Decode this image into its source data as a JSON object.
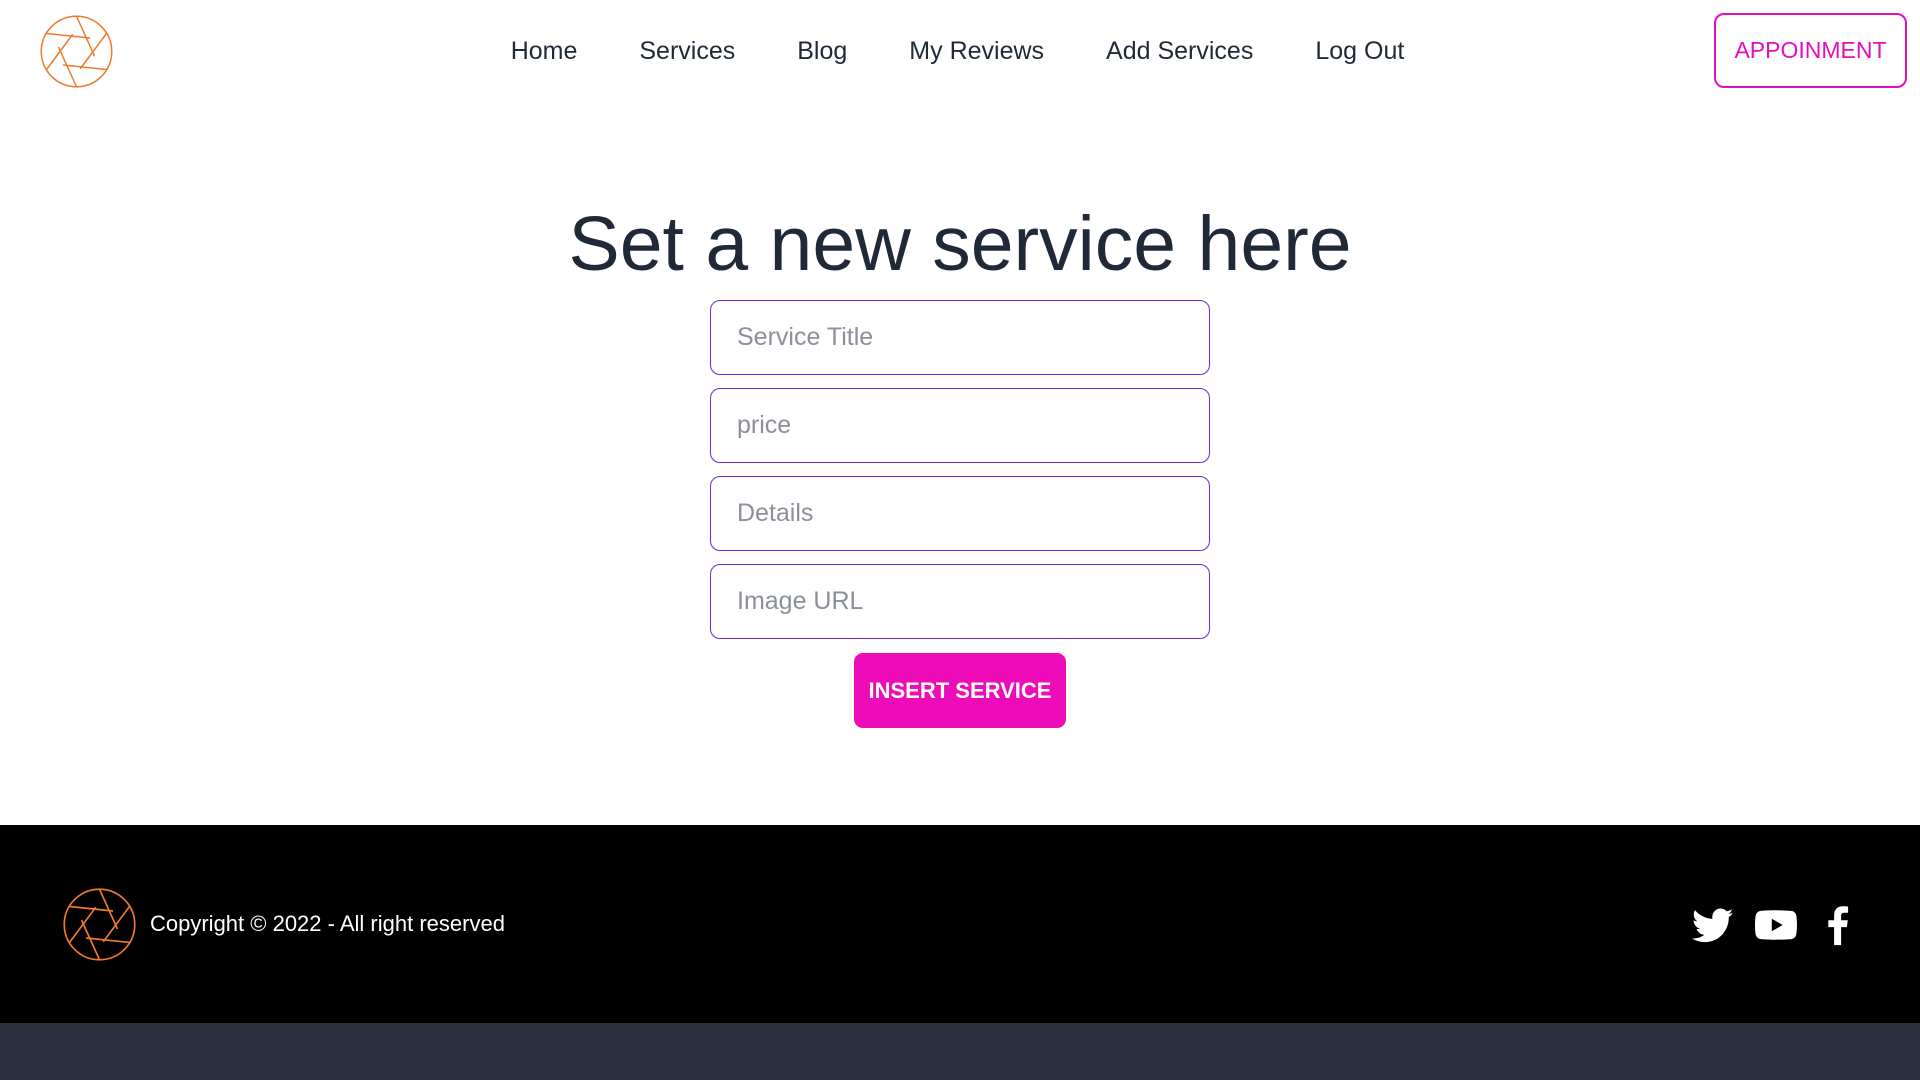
{
  "colors": {
    "accent": "#e30fbf",
    "logo_orange": "#f07a2c",
    "input_border": "#6d28d9",
    "footer_bg": "#000000",
    "text": "#1f2937"
  },
  "header": {
    "logo_icon": "aperture-icon",
    "nav": [
      {
        "label": "Home"
      },
      {
        "label": "Services"
      },
      {
        "label": "Blog"
      },
      {
        "label": "My Reviews"
      },
      {
        "label": "Add Services"
      },
      {
        "label": "Log Out"
      }
    ],
    "cta_label": "APPOINMENT"
  },
  "main": {
    "title": "Set a new service here",
    "fields": {
      "title_placeholder": "Service Title",
      "price_placeholder": "price",
      "details_placeholder": "Details",
      "image_placeholder": "Image URL"
    },
    "submit_label": "INSERT SERVICE"
  },
  "footer": {
    "logo_icon": "aperture-icon",
    "copyright": "Copyright © 2022 - All right reserved",
    "social": [
      "twitter-icon",
      "youtube-icon",
      "facebook-icon"
    ]
  }
}
